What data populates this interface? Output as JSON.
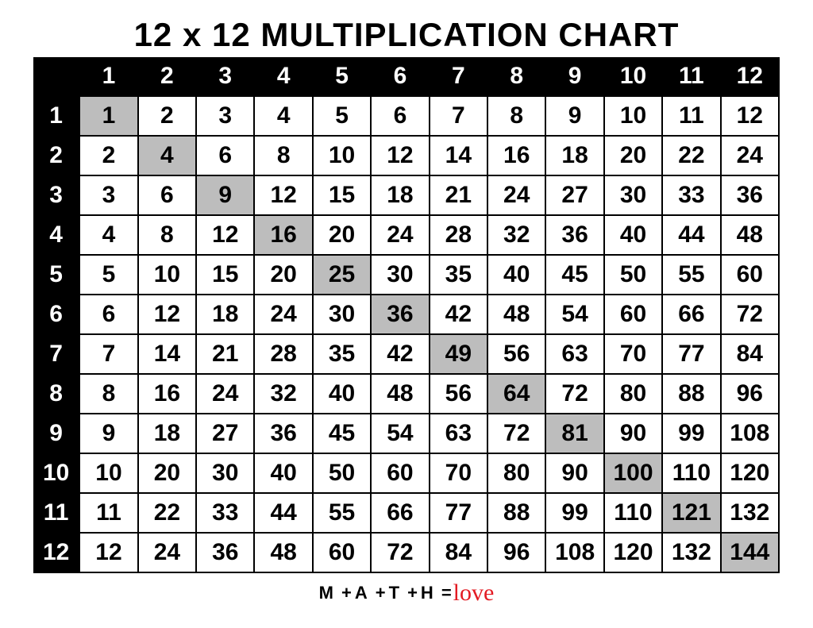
{
  "title": "12 x 12 MULTIPLICATION CHART",
  "chart_data": {
    "type": "table",
    "title": "12 x 12 MULTIPLICATION CHART",
    "col_headers": [
      "1",
      "2",
      "3",
      "4",
      "5",
      "6",
      "7",
      "8",
      "9",
      "10",
      "11",
      "12"
    ],
    "row_headers": [
      "1",
      "2",
      "3",
      "4",
      "5",
      "6",
      "7",
      "8",
      "9",
      "10",
      "11",
      "12"
    ],
    "values": [
      [
        1,
        2,
        3,
        4,
        5,
        6,
        7,
        8,
        9,
        10,
        11,
        12
      ],
      [
        2,
        4,
        6,
        8,
        10,
        12,
        14,
        16,
        18,
        20,
        22,
        24
      ],
      [
        3,
        6,
        9,
        12,
        15,
        18,
        21,
        24,
        27,
        30,
        33,
        36
      ],
      [
        4,
        8,
        12,
        16,
        20,
        24,
        28,
        32,
        36,
        40,
        44,
        48
      ],
      [
        5,
        10,
        15,
        20,
        25,
        30,
        35,
        40,
        45,
        50,
        55,
        60
      ],
      [
        6,
        12,
        18,
        24,
        30,
        36,
        42,
        48,
        54,
        60,
        66,
        72
      ],
      [
        7,
        14,
        21,
        28,
        35,
        42,
        49,
        56,
        63,
        70,
        77,
        84
      ],
      [
        8,
        16,
        24,
        32,
        40,
        48,
        56,
        64,
        72,
        80,
        88,
        96
      ],
      [
        9,
        18,
        27,
        36,
        45,
        54,
        63,
        72,
        81,
        90,
        99,
        108
      ],
      [
        10,
        20,
        30,
        40,
        50,
        60,
        70,
        80,
        90,
        100,
        110,
        120
      ],
      [
        11,
        22,
        33,
        44,
        55,
        66,
        77,
        88,
        99,
        110,
        121,
        132
      ],
      [
        12,
        24,
        36,
        48,
        60,
        72,
        84,
        96,
        108,
        120,
        132,
        144
      ]
    ],
    "diagonal_highlight": true
  },
  "footer": {
    "m": "M",
    "plus": "+",
    "a": "A",
    "t": "T",
    "h": "H",
    "eq": "=",
    "love": "love"
  }
}
